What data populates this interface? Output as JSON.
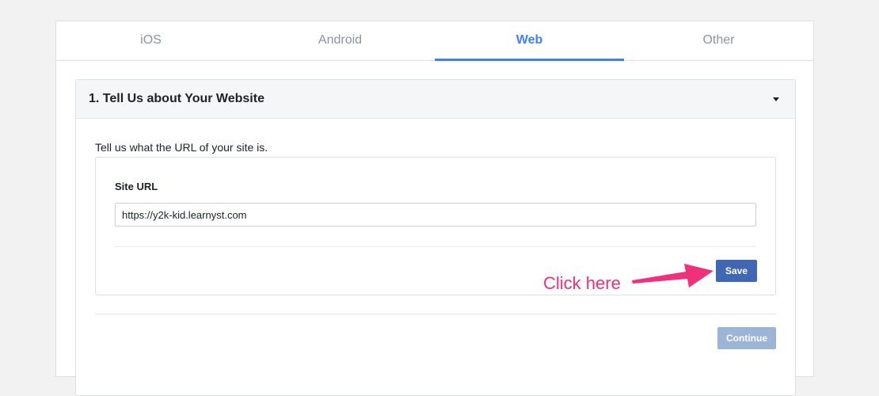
{
  "tabs": [
    {
      "label": "iOS",
      "active": false
    },
    {
      "label": "Android",
      "active": false
    },
    {
      "label": "Web",
      "active": true
    },
    {
      "label": "Other",
      "active": false
    }
  ],
  "section": {
    "title": "1. Tell Us about Your Website",
    "intro": "Tell us what the URL of your site is.",
    "field_label": "Site URL",
    "url_value": "https://y2k-kid.learnyst.com",
    "save_label": "Save",
    "continue_label": "Continue"
  },
  "annotation": {
    "text": "Click here",
    "color": "#f0307a"
  },
  "colors": {
    "accent": "#4080ff",
    "primary_button": "#4267b2",
    "disabled_button": "#9cb4d8"
  },
  "icons": {
    "collapse": "caret-down-icon"
  }
}
